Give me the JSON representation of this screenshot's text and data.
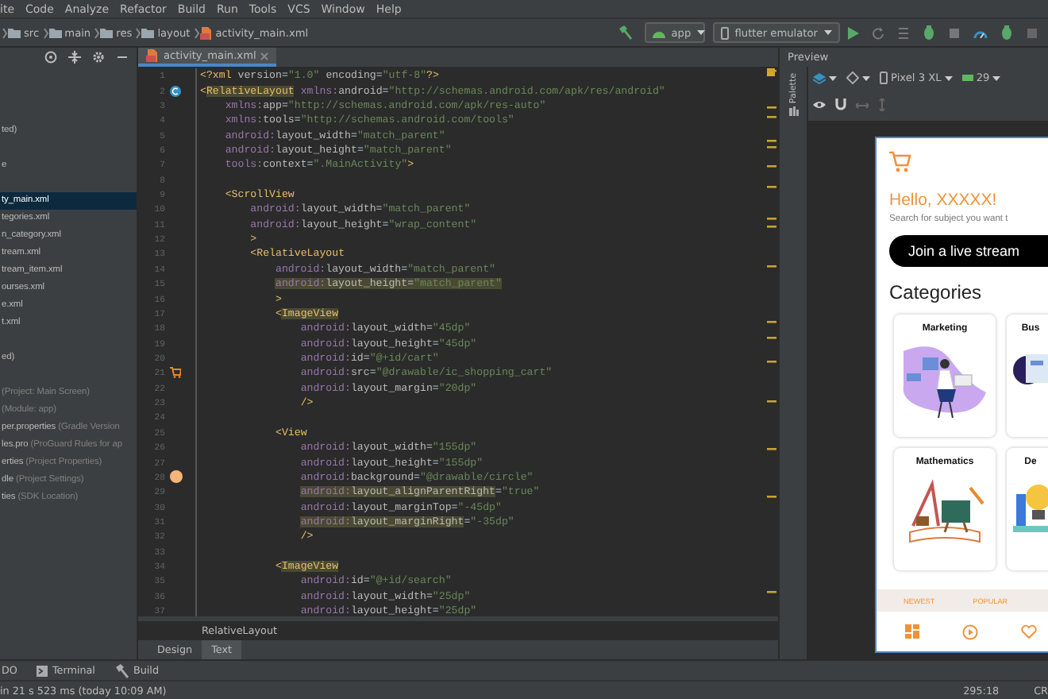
{
  "menu": [
    "ite",
    "Code",
    "Analyze",
    "Refactor",
    "Build",
    "Run",
    "Tools",
    "VCS",
    "Window",
    "Help"
  ],
  "breadcrumb": [
    "src",
    "main",
    "res",
    "layout",
    "activity_main.xml"
  ],
  "run_config": {
    "module": "app",
    "device": "flutter emulator"
  },
  "project_panel": {
    "sections": [
      {
        "items": [
          {
            "name": "ted)",
            "selected": false
          }
        ]
      },
      {
        "items": [
          {
            "name": "e",
            "selected": false
          }
        ]
      },
      {
        "items": [
          {
            "name": "ty_main.xml",
            "selected": true
          },
          {
            "name": "tegories.xml",
            "selected": false
          },
          {
            "name": "n_category.xml",
            "selected": false
          },
          {
            "name": "tream.xml",
            "selected": false
          },
          {
            "name": "tream_item.xml",
            "selected": false
          },
          {
            "name": "ourses.xml",
            "selected": false
          },
          {
            "name": "e.xml",
            "selected": false
          },
          {
            "name": "t.xml",
            "selected": false
          }
        ]
      },
      {
        "items": [
          {
            "name": "ed)",
            "selected": false
          }
        ]
      },
      {
        "items": [
          {
            "hint": "(Project: Main Screen)",
            "selected": false
          },
          {
            "hint": "(Module: app)",
            "selected": false
          },
          {
            "name": "per.properties",
            "hint": "(Gradle Version",
            "selected": false
          },
          {
            "name": "les.pro",
            "hint": "(ProGuard Rules for ap",
            "selected": false
          },
          {
            "name": "erties",
            "hint": "(Project Properties)",
            "selected": false
          },
          {
            "name": "dle",
            "hint": "(Project Settings)",
            "selected": false
          },
          {
            "name": "ties",
            "hint": "(SDK Location)",
            "selected": false
          }
        ]
      }
    ]
  },
  "editor": {
    "tab": {
      "label": "activity_main.xml",
      "selected": true
    },
    "lines": [
      {
        "number": "1",
        "text": "<?xml version=\"1.0\" encoding=\"utf-8\"?>"
      },
      {
        "number": "2",
        "text": "<RelativeLayout xmlns:android=\"http://schemas.android.com/apk/res/android\"",
        "highlight": {
          "kind": "tag"
        },
        "gutter": {
          "kind": "class"
        }
      },
      {
        "number": "3",
        "text": "    xmlns:app=\"http://schemas.android.com/apk/res-auto\""
      },
      {
        "number": "4",
        "text": "    xmlns:tools=\"http://schemas.android.com/tools\""
      },
      {
        "number": "5",
        "text": "    android:layout_width=\"match_parent\""
      },
      {
        "number": "6",
        "text": "    android:layout_height=\"match_parent\""
      },
      {
        "number": "7",
        "text": "    tools:context=\".MainActivity\">"
      },
      {
        "number": "8"
      },
      {
        "number": "9",
        "text": "    <ScrollView"
      },
      {
        "number": "10",
        "text": "        android:layout_width=\"match_parent\""
      },
      {
        "number": "11",
        "text": "        android:layout_height=\"wrap_content\""
      },
      {
        "number": "12",
        "text": "        >"
      },
      {
        "number": "13",
        "text": "        <RelativeLayout"
      },
      {
        "number": "14",
        "text": "            android:layout_width=\"match_parent\""
      },
      {
        "number": "15",
        "text": "            android:layout_height=\"match_parent\"",
        "highlight": {
          "kind": "line"
        }
      },
      {
        "number": "16",
        "text": "            >"
      },
      {
        "number": "17",
        "text": "            <ImageView",
        "highlight": {
          "kind": "tag"
        }
      },
      {
        "number": "18",
        "text": "                android:layout_width=\"45dp\""
      },
      {
        "number": "19",
        "text": "                android:layout_height=\"45dp\""
      },
      {
        "number": "20",
        "text": "                android:id=\"@+id/cart\""
      },
      {
        "number": "21",
        "text": "                android:src=\"@drawable/ic_shopping_cart\"",
        "gutter": {
          "kind": "cart"
        }
      },
      {
        "number": "22",
        "text": "                android:layout_margin=\"20dp\""
      },
      {
        "number": "23",
        "text": "                />"
      },
      {
        "number": "24"
      },
      {
        "number": "25",
        "text": "            <View"
      },
      {
        "number": "26",
        "text": "                android:layout_width=\"155dp\""
      },
      {
        "number": "27",
        "text": "                android:layout_height=\"155dp\""
      },
      {
        "number": "28",
        "text": "                android:background=\"@drawable/circle\"",
        "gutter": {
          "kind": "swatch"
        }
      },
      {
        "number": "29",
        "text": "                android:layout_alignParentRight=\"true\"",
        "highlight": {
          "kind": "attr"
        }
      },
      {
        "number": "30",
        "text": "                android:layout_marginTop=\"-45dp\""
      },
      {
        "number": "31",
        "text": "                android:layout_marginRight=\"-35dp\"",
        "highlight": {
          "kind": "attr"
        }
      },
      {
        "number": "32",
        "text": "                />"
      },
      {
        "number": "33"
      },
      {
        "number": "34",
        "text": "            <ImageView",
        "highlight": {
          "kind": "tag"
        }
      },
      {
        "number": "35",
        "text": "                android:id=\"@+id/search\""
      },
      {
        "number": "36",
        "text": "                android:layout_width=\"25dp\""
      },
      {
        "number": "37",
        "text": "                android:layout_height=\"25dp\""
      }
    ],
    "breadcrumb": "RelativeLayout",
    "view_tabs": [
      {
        "label": "Design",
        "selected": false
      },
      {
        "label": "Text",
        "selected": true
      }
    ]
  },
  "preview": {
    "title": "Preview",
    "palette": "Palette",
    "device": "Pixel 3 XL",
    "api": "29",
    "app": {
      "greeting": "Hello, XXXXX!",
      "subtitle": "Search for subject you want t",
      "button": "Join a live stream",
      "section": "Categories",
      "categories": [
        {
          "label": "Marketing",
          "kind": "marketing"
        },
        {
          "label": "Bus",
          "kind": "business"
        },
        {
          "label": "Mathematics",
          "kind": "math"
        },
        {
          "label": "De",
          "kind": "idea"
        }
      ],
      "tabs": [
        "NEWEST",
        "POPULAR"
      ]
    }
  },
  "tool_windows": [
    "DO",
    "Terminal",
    "Build"
  ],
  "status_bar": {
    "message": "in 21 s 523 ms (today 10:09 AM)",
    "position": "295:18",
    "encoding": "CR"
  }
}
